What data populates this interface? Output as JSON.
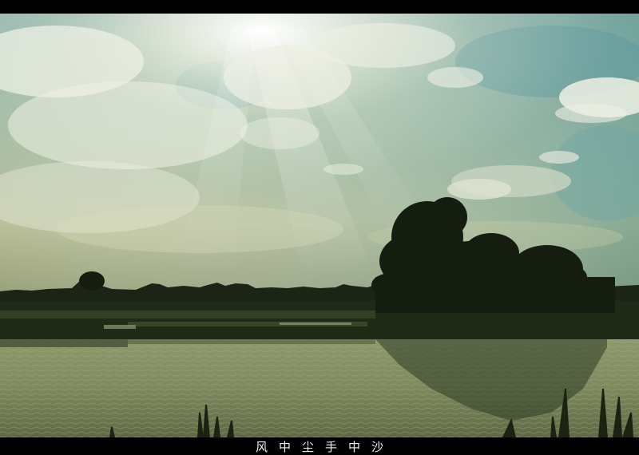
{
  "caption": "风中尘手中沙"
}
